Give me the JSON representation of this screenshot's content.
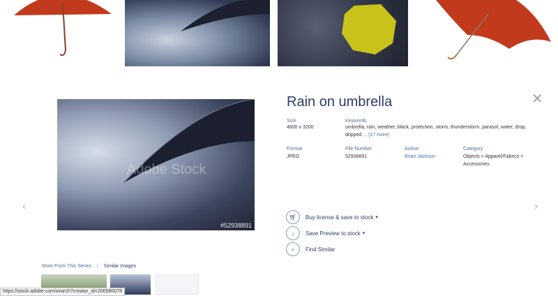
{
  "watermark": "Adobe Stock",
  "image_number": "#52938891",
  "detail": {
    "title": "Rain on umbrella",
    "size_label": "Size",
    "size_value": "4800 x 3200",
    "keywords_label": "Keywords",
    "keywords_value": "umbrella, rain, weather, black, protection, storm, thunderstorm, parasol, water, drop, dripped ...",
    "keywords_more": "(17 more)",
    "format_label": "Format",
    "format_value": "JPEG",
    "file_number_label": "File Number",
    "file_number_value": "52938891",
    "author_label": "Author",
    "author_value": "Brian Jackson",
    "category_label": "Category",
    "category_value": "Objects > Apparel/Fabrics > Accessories"
  },
  "actions": {
    "buy": "Buy license & save to stock",
    "save_preview": "Save Preview to stock",
    "find_similar": "Find Similar"
  },
  "tabs": {
    "more_series": "More From This Series",
    "similar": "Similar Images"
  },
  "status_url": "https://stock.adobe.com/search?creator_id=200580078",
  "colors": {
    "accent": "#2c3e66",
    "link": "#3c6fb6",
    "umbrella_red": "#c23a1c",
    "umbrella_yellow": "#c9c21a"
  }
}
